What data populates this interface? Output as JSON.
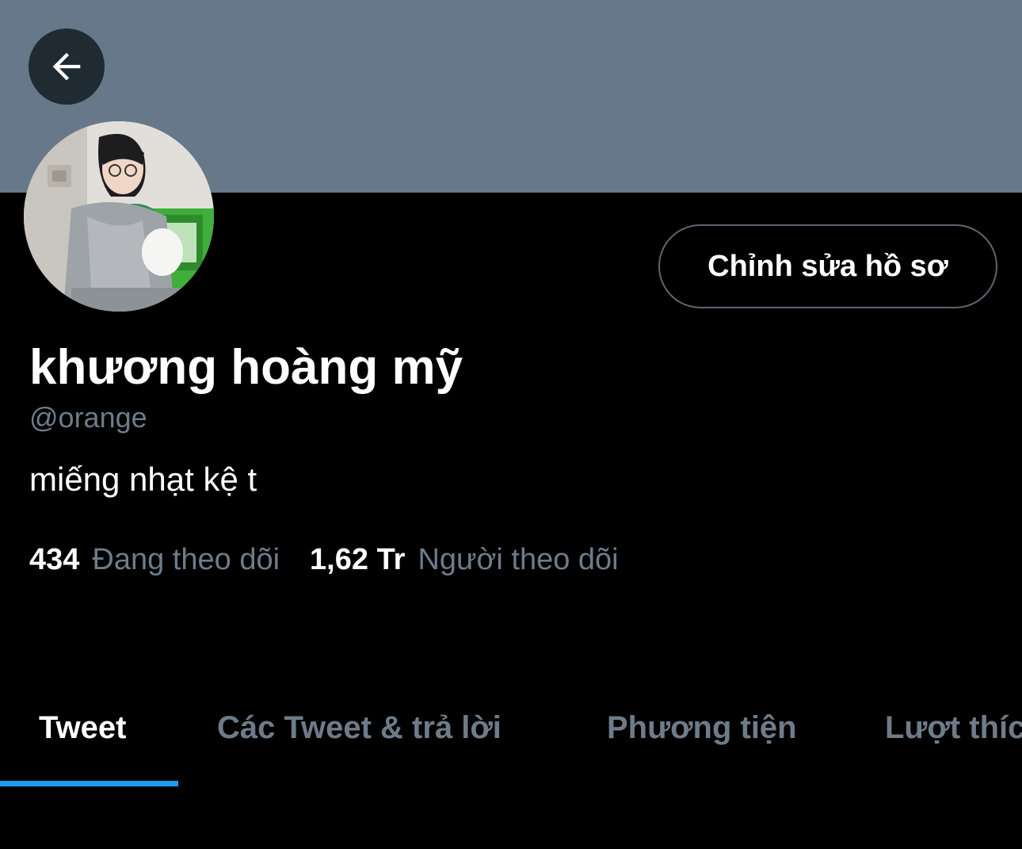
{
  "profile": {
    "display_name": "khương hoàng mỹ",
    "handle": "@orange",
    "bio": "miếng nhạt kệ t",
    "edit_button_label": "Chỉnh sửa hồ sơ",
    "banner_color": "#66788a"
  },
  "stats": {
    "following_count": "434",
    "following_label": "Đang theo dõi",
    "followers_count": "1,62 Tr",
    "followers_label": "Người theo dõi"
  },
  "tabs": [
    {
      "label": "Tweet",
      "active": true
    },
    {
      "label": "Các Tweet & trả lời",
      "active": false
    },
    {
      "label": "Phương tiện",
      "active": false
    },
    {
      "label": "Lượt thích",
      "active": false
    }
  ],
  "icons": {
    "back": "arrow-left-icon"
  },
  "colors": {
    "background": "#000000",
    "muted_text": "#6e7c89",
    "accent": "#1d9bf0"
  }
}
